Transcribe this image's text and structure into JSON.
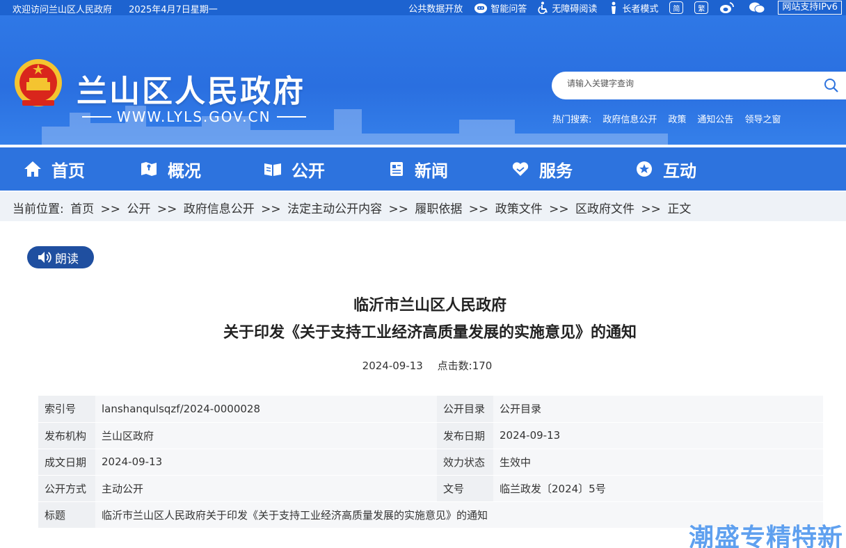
{
  "topbar": {
    "welcome": "欢迎访问兰山区人民政府",
    "date": "2025年4月7日星期一",
    "links": [
      "公共数据开放",
      "智能问答",
      "无障碍阅读",
      "长者模式"
    ],
    "simplified": "简",
    "traditional": "繁",
    "ipv6": "网站支持IPv6"
  },
  "header": {
    "title": "兰山区人民政府",
    "url": "WWW.LYLS.GOV.CN",
    "search_placeholder": "请输入关键字查询",
    "hot_label": "热门搜索:",
    "hot_items": [
      "政府信息公开",
      "政策",
      "通知公告",
      "领导之窗"
    ]
  },
  "nav": {
    "items": [
      "首页",
      "概况",
      "公开",
      "新闻",
      "服务",
      "互动"
    ]
  },
  "breadcrumb": {
    "label": "当前位置:",
    "items": [
      "首页",
      "公开",
      "政府信息公开",
      "法定主动公开内容",
      "履职依据",
      "政策文件",
      "区政府文件",
      "正文"
    ],
    "sep": ">>"
  },
  "article": {
    "read_label": "朗读",
    "title_line1": "临沂市兰山区人民政府",
    "title_line2": "关于印发《关于支持工业经济高质量发展的实施意见》的通知",
    "date": "2024-09-13",
    "clicks": "点击数:170"
  },
  "info_table": {
    "rows": [
      {
        "l1": "索引号",
        "v1": "lanshanqulsqzf/2024-0000028",
        "l2": "公开目录",
        "v2": "公开目录"
      },
      {
        "l1": "发布机构",
        "v1": "兰山区政府",
        "l2": "发布日期",
        "v2": "2024-09-13"
      },
      {
        "l1": "成文日期",
        "v1": "2024-09-13",
        "l2": "效力状态",
        "v2": "生效中"
      },
      {
        "l1": "公开方式",
        "v1": "主动公开",
        "l2": "文号",
        "v2": "临兰政发〔2024〕5号"
      }
    ],
    "last_label": "标题",
    "last_value": "临沂市兰山区人民政府关于印发《关于支持工业经济高质量发展的实施意见》的通知"
  },
  "watermark": "潮盛专精特新",
  "colors": {
    "primary": "#2d73de",
    "topbar": "#1d63d0",
    "read_button": "#1f4fa0"
  }
}
